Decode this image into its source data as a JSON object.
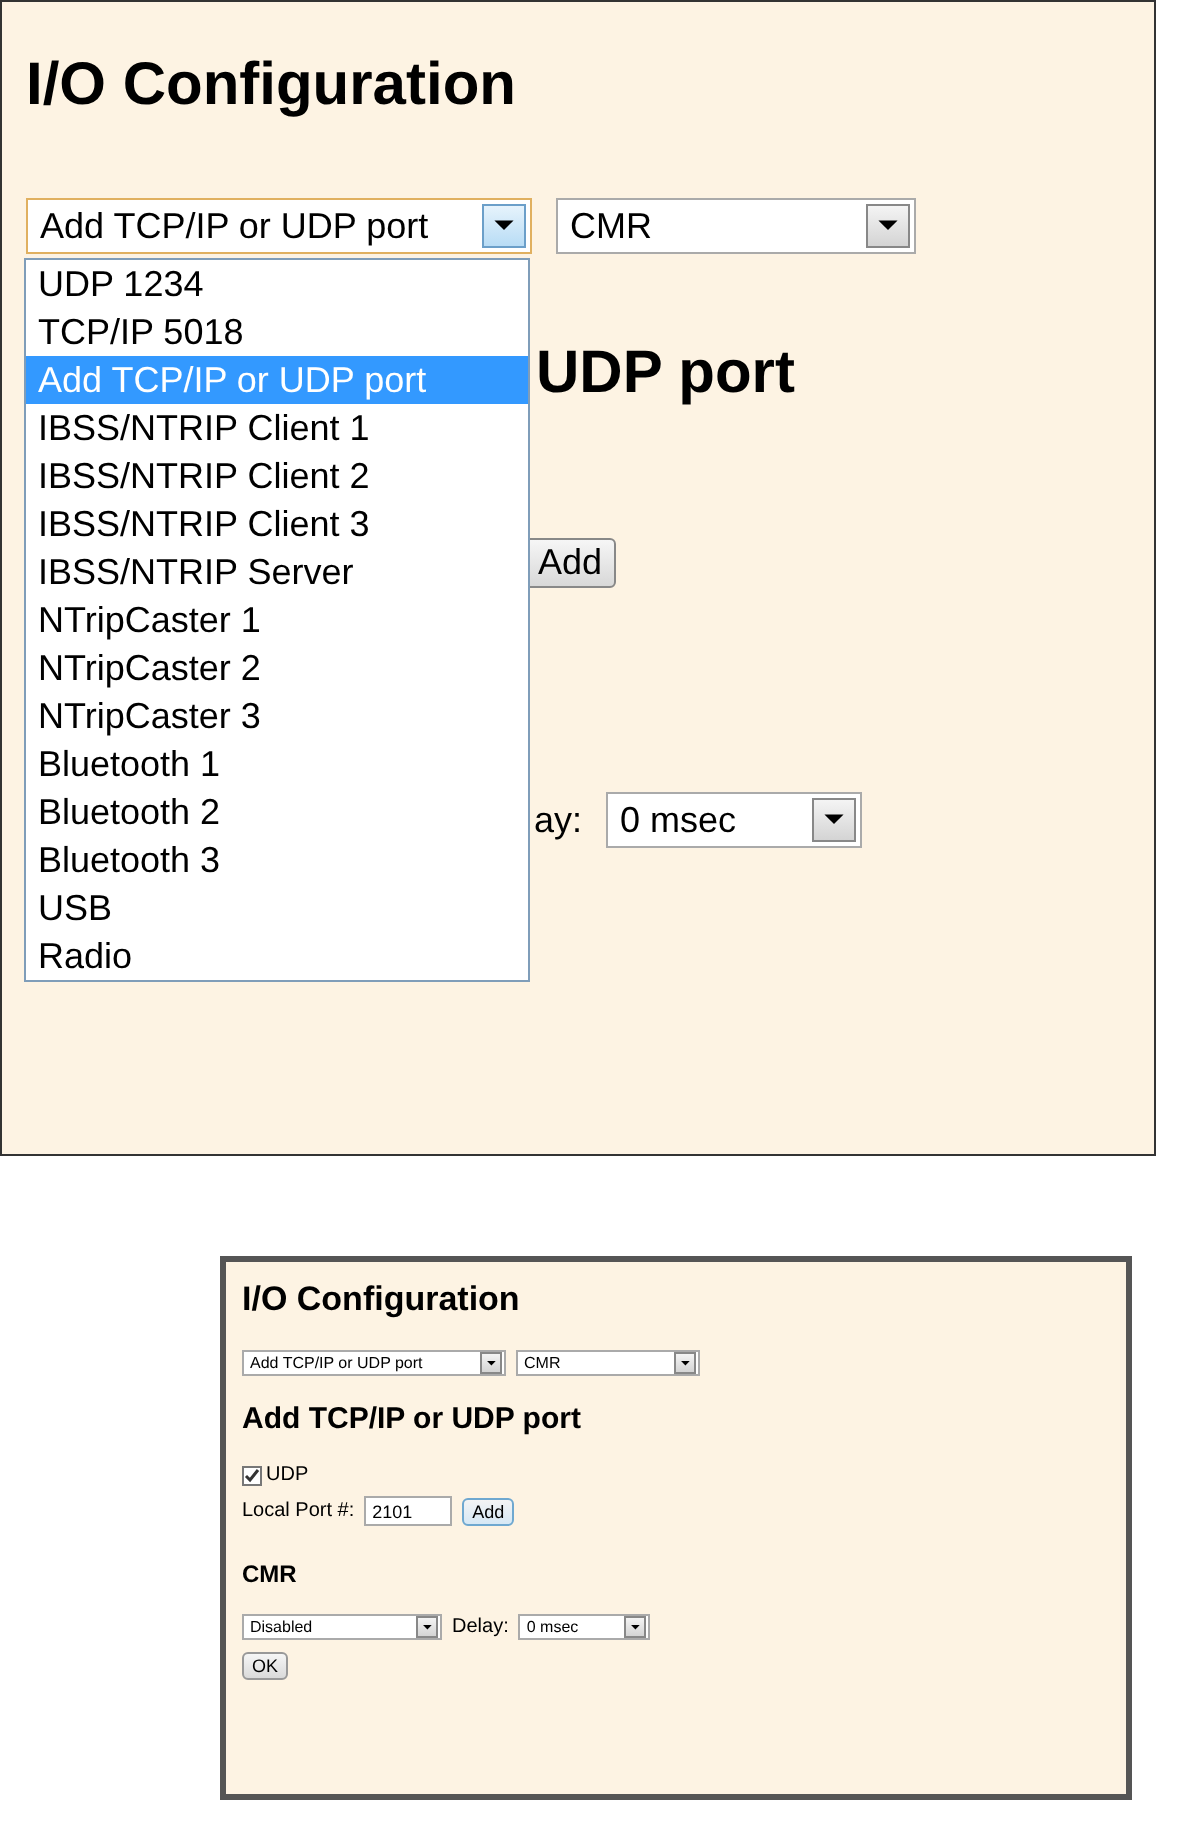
{
  "expanded_view": {
    "title": "I/O Configuration",
    "port_select": {
      "value": "Add TCP/IP or UDP port"
    },
    "format_select": {
      "value": "CMR"
    },
    "dropdown": {
      "items": [
        {
          "label": "UDP 1234",
          "selected": false
        },
        {
          "label": "TCP/IP 5018",
          "selected": false
        },
        {
          "label": "Add TCP/IP or UDP port",
          "selected": true
        },
        {
          "label": "IBSS/NTRIP Client 1",
          "selected": false
        },
        {
          "label": "IBSS/NTRIP Client 2",
          "selected": false
        },
        {
          "label": "IBSS/NTRIP Client 3",
          "selected": false
        },
        {
          "label": "IBSS/NTRIP Server",
          "selected": false
        },
        {
          "label": "NTripCaster 1",
          "selected": false
        },
        {
          "label": "NTripCaster 2",
          "selected": false
        },
        {
          "label": "NTripCaster 3",
          "selected": false
        },
        {
          "label": "Bluetooth 1",
          "selected": false
        },
        {
          "label": "Bluetooth 2",
          "selected": false
        },
        {
          "label": "Bluetooth 3",
          "selected": false
        },
        {
          "label": "USB",
          "selected": false
        },
        {
          "label": "Radio",
          "selected": false
        }
      ]
    },
    "section_heading": "UDP port",
    "add_button": "Add",
    "delay_label": "ay:",
    "delay_select": {
      "value": "0 msec"
    }
  },
  "collapsed_view": {
    "title": "I/O Configuration",
    "port_select": {
      "value": "Add TCP/IP or UDP port"
    },
    "format_select": {
      "value": "CMR"
    },
    "section_heading": "Add TCP/IP or UDP port",
    "udp_checkbox": {
      "label": "UDP",
      "checked": true
    },
    "local_port_label": "Local Port #:",
    "local_port_field": {
      "value": "2101"
    },
    "add_button": "Add",
    "cmr_heading": "CMR",
    "mode_select": {
      "value": "Disabled"
    },
    "delay_label": "Delay:",
    "delay_select": {
      "value": "0 msec"
    },
    "ok_button": "OK"
  }
}
